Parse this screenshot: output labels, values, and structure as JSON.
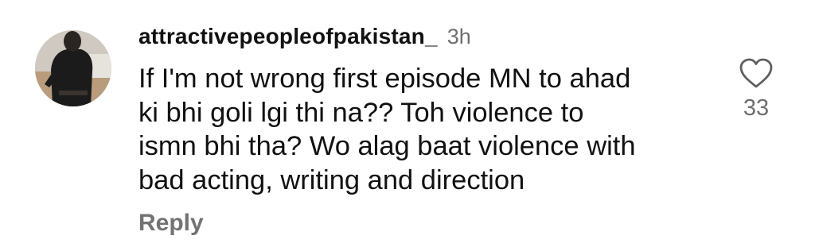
{
  "comment": {
    "username": "attractivepeopleofpakistan_",
    "time": "3h",
    "text": "If I'm not wrong first episode MN to ahad\nki bhi goli lgi thi na?? Toh violence to\nismn bhi tha? Wo alag baat violence with\nbad acting, writing and direction",
    "reply_label": "Reply",
    "like_count": "33",
    "icons": {
      "like": "heart-outline-icon",
      "avatar": "profile-photo"
    },
    "colors": {
      "text": "#111111",
      "muted": "#6f6f6f",
      "reply": "#737373"
    }
  }
}
